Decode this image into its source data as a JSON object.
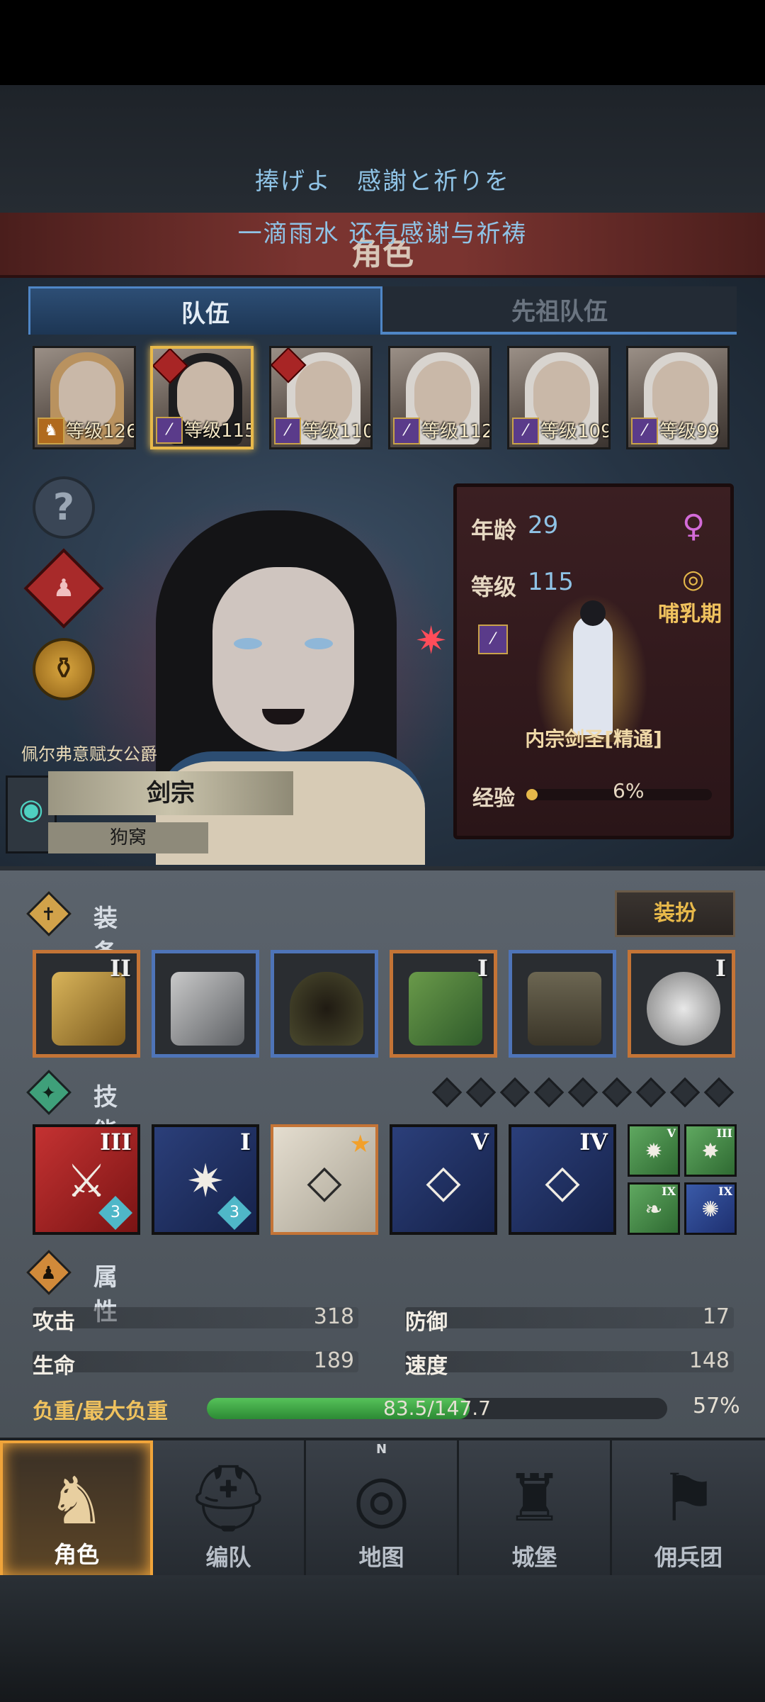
{
  "lyrics": {
    "line1": "捧げよ　感謝と祈りを",
    "line2": "一滴雨水 还有感谢与祈祷"
  },
  "header": {
    "title": "角色"
  },
  "tabs": {
    "team": "队伍",
    "ancestor": "先祖队伍"
  },
  "roster": [
    {
      "level": "等级126",
      "hair": "blond",
      "class_icon": "horse-icon"
    },
    {
      "level": "等级115",
      "hair": "dark",
      "class_icon": "sword-icon",
      "selected": true
    },
    {
      "level": "等级110",
      "hair": "white",
      "class_icon": "sword-icon"
    },
    {
      "level": "等级112",
      "hair": "white",
      "class_icon": "sword-icon"
    },
    {
      "level": "等级109",
      "hair": "white",
      "class_icon": "sword-icon"
    },
    {
      "level": "等级99",
      "hair": "white",
      "class_icon": "sword-icon"
    }
  ],
  "hero": {
    "title": "佩尔弗意赋女公爵",
    "class": "剑宗",
    "house": "狗窝"
  },
  "stat_card": {
    "age_label": "年龄",
    "age": "29",
    "level_label": "等级",
    "level": "115",
    "life_stage": "哺乳期",
    "class_name": "内宗剑圣[精通]",
    "xp_label": "经验",
    "xp_percent": "6%",
    "xp_fraction": 0.06,
    "gender_icon": "female-icon"
  },
  "equipment": {
    "label": "装备",
    "dress_button": "装扮",
    "slots": [
      {
        "roman": "II",
        "rarity": "orange",
        "icon": "gold-armor-icon"
      },
      {
        "roman": "",
        "rarity": "blue",
        "icon": "sword-icon"
      },
      {
        "roman": "",
        "rarity": "blue",
        "icon": "hood-icon"
      },
      {
        "roman": "I",
        "rarity": "orange",
        "icon": "green-armor-icon"
      },
      {
        "roman": "",
        "rarity": "blue",
        "icon": "boots-icon"
      },
      {
        "roman": "I",
        "rarity": "orange",
        "icon": "amulet-icon"
      }
    ]
  },
  "skills": {
    "label": "技能",
    "active": [
      {
        "roman": "III",
        "style": "red",
        "glyph": "⚔",
        "count": "3"
      },
      {
        "roman": "I",
        "style": "navy",
        "glyph": "✷",
        "count": "3"
      },
      {
        "roman": "",
        "style": "gold",
        "glyph": "◇",
        "count": ""
      },
      {
        "roman": "V",
        "style": "navy",
        "glyph": "◇",
        "count": ""
      },
      {
        "roman": "IV",
        "style": "navy",
        "glyph": "◇",
        "count": ""
      }
    ],
    "passive": [
      {
        "roman": "V",
        "style": "green",
        "glyph": "✹"
      },
      {
        "roman": "III",
        "style": "green",
        "glyph": "✸"
      },
      {
        "roman": "IX",
        "style": "green",
        "glyph": "❧"
      },
      {
        "roman": "IX",
        "style": "blue",
        "glyph": "✺"
      }
    ]
  },
  "attributes": {
    "label": "属性",
    "attack_label": "攻击",
    "attack": "318",
    "defense_label": "防御",
    "defense": "17",
    "hp_label": "生命",
    "hp": "189",
    "speed_label": "速度",
    "speed": "148",
    "load_label": "负重/最大负重",
    "load": "83.5/147.7",
    "load_percent": "57%",
    "load_fraction": 0.57
  },
  "nav": [
    {
      "label": "角色",
      "icon": "knight-icon",
      "active": true
    },
    {
      "label": "编队",
      "icon": "helmet-icon"
    },
    {
      "label": "地图",
      "icon": "compass-icon",
      "north": "N"
    },
    {
      "label": "城堡",
      "icon": "castle-icon"
    },
    {
      "label": "佣兵团",
      "icon": "banner-icon"
    }
  ],
  "colors": {
    "accent_gold": "#e8b94a",
    "tab_blue": "#4f86c6",
    "lyric_blue": "#8fc3e6"
  }
}
